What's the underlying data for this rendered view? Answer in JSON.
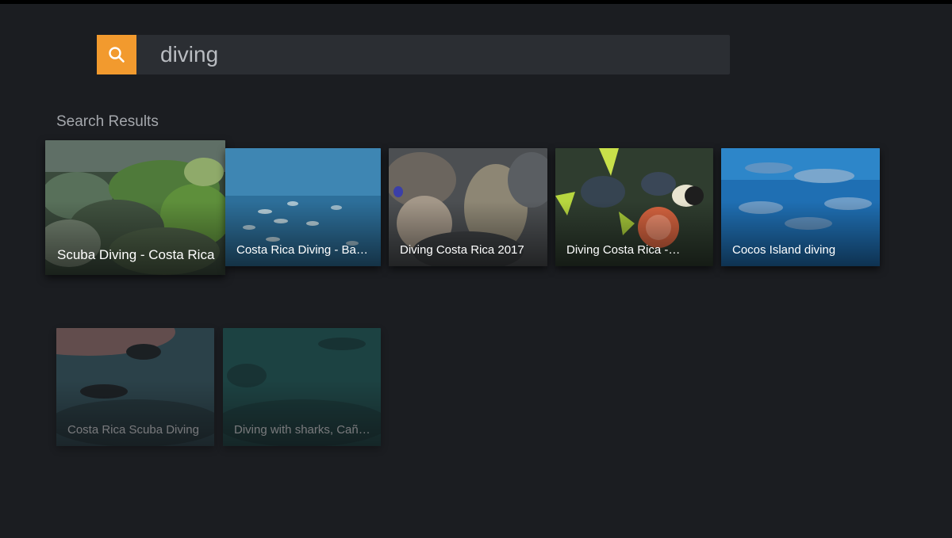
{
  "search": {
    "query": "diving",
    "button_icon": "search-icon",
    "accent_color": "#f29a2e"
  },
  "results": {
    "heading": "Search Results",
    "items": [
      {
        "title": "Scuba Diving - Costa Rica",
        "focused": true
      },
      {
        "title": "Costa Rica Diving - Bat…"
      },
      {
        "title": "Diving Costa Rica 2017"
      },
      {
        "title": "Diving Costa Rica -…"
      },
      {
        "title": "Cocos Island diving"
      },
      {
        "title": "Costa Rica Scuba Diving"
      },
      {
        "title": "Diving with sharks, Caño…"
      }
    ]
  }
}
